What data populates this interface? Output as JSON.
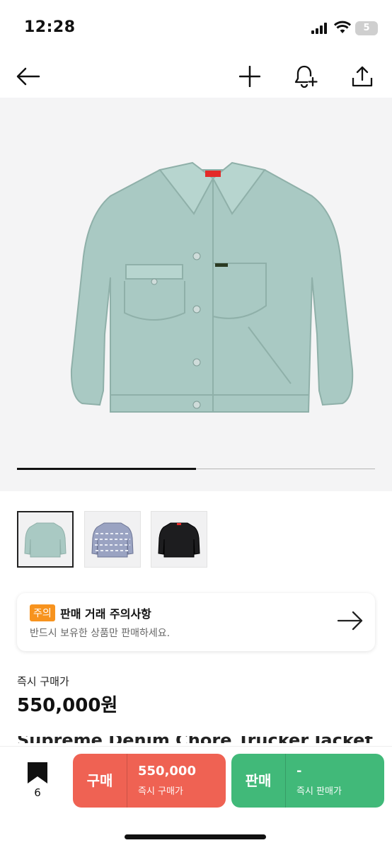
{
  "status": {
    "time": "12:28",
    "battery": "5"
  },
  "hero": {
    "slide_progress": 0.5
  },
  "notice": {
    "tag": "주의",
    "title": "판매 거래 주의사항",
    "subtitle": "반드시 보유한 상품만 판매하세요."
  },
  "price": {
    "label": "즉시 구매가",
    "value": "550,000원"
  },
  "product_title_partial": "Supreme Denim Chore Trucker Jacket Mint",
  "bottom": {
    "bookmark_count": "6",
    "buy": {
      "label": "구매",
      "value": "550,000",
      "caption": "즉시 구매가"
    },
    "sell": {
      "label": "판매",
      "value": "-",
      "caption": "즉시 판매가"
    }
  },
  "colors": {
    "buy": "#ef6253",
    "sell": "#41b979",
    "notice_tag": "#f7931e"
  }
}
